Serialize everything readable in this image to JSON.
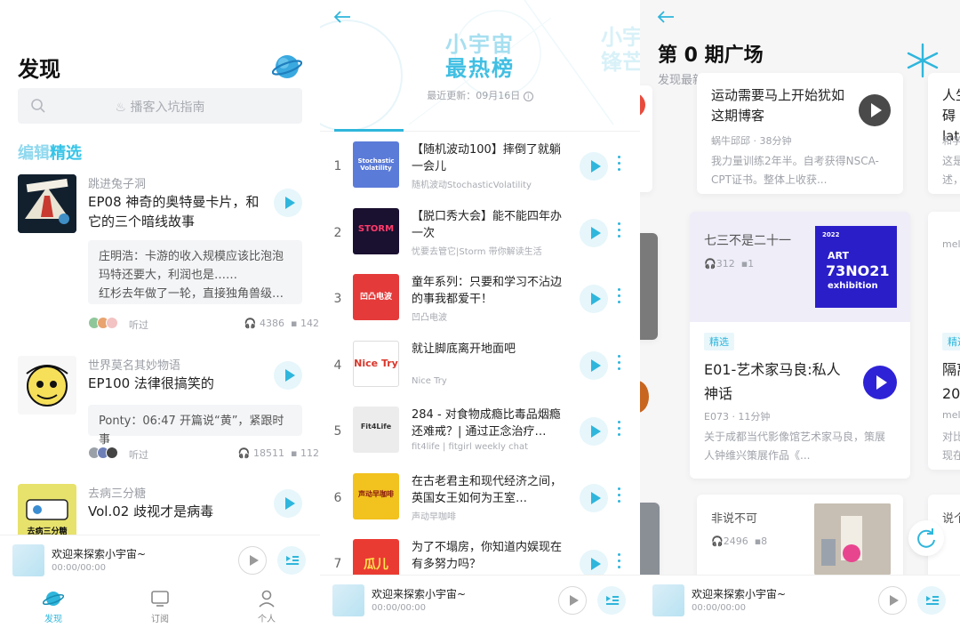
{
  "colors": {
    "accent": "#2fb6dc",
    "accent_light": "#e6f6fb",
    "art_blue": "#2a1ec9",
    "play_blue": "#2e22d6"
  },
  "discover": {
    "title": "发现",
    "search_placeholder": "播客入坑指南",
    "section": {
      "a": "编辑",
      "b": "精选"
    },
    "items": [
      {
        "source": "跳进兔子洞",
        "episode": "EP08 神奇的奥特曼卡片，和它的三个暗线故事",
        "quote": "庄明浩：卡游的收入规模应该比泡泡玛特还要大，利润也是……\n红杉去年做了一轮，直接独角兽级…",
        "listened": "听过",
        "plays": "4386",
        "comments": "142"
      },
      {
        "source": "世界莫名其妙物语",
        "episode": "EP100 法律很搞笑的",
        "quote": "Ponty：06:47 开篇说“黄”，紧跟时事",
        "listened": "听过",
        "plays": "18511",
        "comments": "112"
      },
      {
        "source": "去病三分糖",
        "episode": "Vol.02 歧视才是病毒",
        "cover_text": "去病三分糖"
      }
    ],
    "player": {
      "title": "欢迎来探索小宇宙~",
      "time": "00:00/00:00"
    },
    "tabs": [
      {
        "label": "发现",
        "icon": "planet-icon"
      },
      {
        "label": "订阅",
        "icon": "tv-icon"
      },
      {
        "label": "个人",
        "icon": "person-icon"
      }
    ]
  },
  "ranking": {
    "title_line1": "小宇宙",
    "title_line2": "最热榜",
    "ghost_text": "小宇\n锋芒",
    "updated": "最近更新：09月16日",
    "items": [
      {
        "rank": "1",
        "title": "【随机波动100】摔倒了就躺一会儿",
        "source": "随机波动StochasticVolatility",
        "cover_text": "Stochastic Volatility"
      },
      {
        "rank": "2",
        "title": "【脱口秀大会】能不能四年办一次",
        "source": "忧要去管它|Storm 带你解读生活",
        "cover_text": "STORM"
      },
      {
        "rank": "3",
        "title": "童年系列：只要和学习不沾边的事我都爱干！",
        "source": "凹凸电波",
        "cover_text": "凹凸电波"
      },
      {
        "rank": "4",
        "title": "就让脚底离开地面吧",
        "source": "Nice Try",
        "cover_text": "Nice Try"
      },
      {
        "rank": "5",
        "title": "284 - 对食物成瘾比毒品烟瘾还难戒？| 通过正念治疗…",
        "source": "fit4life | fitgirl weekly chat",
        "cover_text": "Fit4Life"
      },
      {
        "rank": "6",
        "title": "在古老君主和现代经济之间，英国女王如何为王室…",
        "source": "声动早咖啡",
        "cover_text": "声动早咖啡"
      },
      {
        "rank": "7",
        "title": "为了不塌房，你知道内娱现在有多努力吗？",
        "source": "",
        "cover_text": "瓜儿"
      }
    ],
    "player": {
      "title": "欢迎来探索小宇宙~",
      "time": "00:00/00:00"
    }
  },
  "plaza": {
    "title": "第 0 期广场",
    "subtitle": "发现最新的试播单集",
    "card_top": {
      "title": "运动需要马上开始犹如这期博客",
      "meta": "蜗牛邱邱 · 38分钟",
      "desc": "我力量训练2年半。自考获得NSCA-CPT证书。整体上收获..."
    },
    "card_right_top": {
      "line1": "人生",
      "line2": "碍later",
      "meta": "和学",
      "desc1": "这是",
      "desc2": "述，"
    },
    "card_main": {
      "podcast": "七三不是二十一",
      "plays": "312",
      "comments": "1",
      "art_year": "2022",
      "art_line1": "ART",
      "art_line2": "73NO21",
      "art_line3": "exhibition",
      "chip": "精选",
      "title": "E01-艺术家马良:私人神话",
      "meta": "E073 · 11分钟",
      "desc": "关于成都当代影像馆艺术家马良，策展人钟维兴策展作品《..."
    },
    "card_right_mid": {
      "meta": "mel",
      "chip": "精选",
      "line1": "隔离",
      "line2": "20",
      "meta2": "mel",
      "desc1": "对比",
      "desc2": "现在"
    },
    "card_bottom": {
      "podcast": "非说不可",
      "plays": "2496",
      "comments": "8"
    },
    "card_right_bottom": {
      "text": "说个"
    },
    "player": {
      "title": "欢迎来探索小宇宙~",
      "time": "00:00/00:00"
    }
  }
}
